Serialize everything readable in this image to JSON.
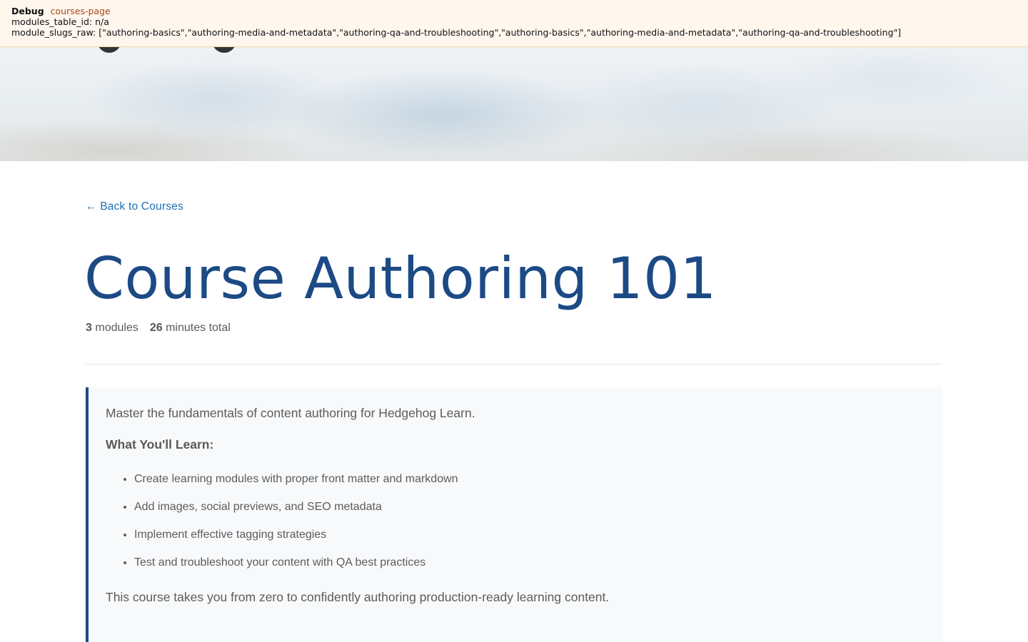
{
  "debug": {
    "title": "Debug",
    "tag": "courses-page",
    "line1": "modules_table_id: n/a",
    "line2": "module_slugs_raw: [\"authoring-basics\",\"authoring-media-and-metadata\",\"authoring-qa-and-troubleshooting\",\"authoring-basics\",\"authoring-media-and-metadata\",\"authoring-qa-and-troubleshooting\"]"
  },
  "nav": {
    "back_label": "← Back to Courses"
  },
  "course": {
    "title": "Course Authoring 101",
    "modules_count": "3",
    "modules_label": "modules",
    "minutes_total": "26",
    "minutes_label": "minutes total"
  },
  "description": {
    "intro": "Master the fundamentals of content authoring for Hedgehog Learn.",
    "heading": "What You'll Learn:",
    "items": [
      "Create learning modules with proper front matter and markdown",
      "Add images, social previews, and SEO metadata",
      "Implement effective tagging strategies",
      "Test and troubleshoot your content with QA best practices"
    ],
    "outro": "This course takes you from zero to confidently authoring production-ready learning content."
  },
  "colors": {
    "title": "#1c4a85",
    "link": "#1f6fb2",
    "card_accent": "#1c4a85",
    "debug_background": "#fff6ee"
  }
}
